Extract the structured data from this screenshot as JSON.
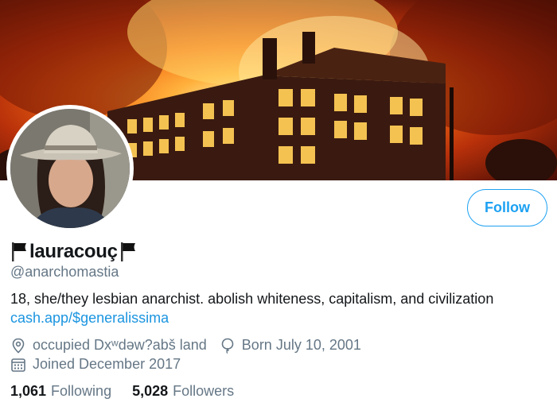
{
  "profile": {
    "display_name": "lauracouç",
    "handle": "@anarchomastia",
    "bio": "18, she/they lesbian anarchist. abolish whiteness, capitalism, and civilization",
    "link": "cash.app/$generalissima",
    "location": "occupied Dxʷdəw?abš land",
    "birthday": "Born July 10, 2001",
    "joined": "Joined December 2017"
  },
  "actions": {
    "follow_label": "Follow"
  },
  "stats": {
    "following_count": "1,061",
    "following_label": "Following",
    "followers_count": "5,028",
    "followers_label": "Followers"
  },
  "colors": {
    "accent": "#1da1f2",
    "link": "#1b95e0",
    "muted": "#657786"
  },
  "icons": {
    "name_prefix": "black-flag-icon",
    "name_suffix": "black-flag-icon",
    "location": "location-pin-icon",
    "birthday": "balloon-icon",
    "joined": "calendar-icon"
  }
}
